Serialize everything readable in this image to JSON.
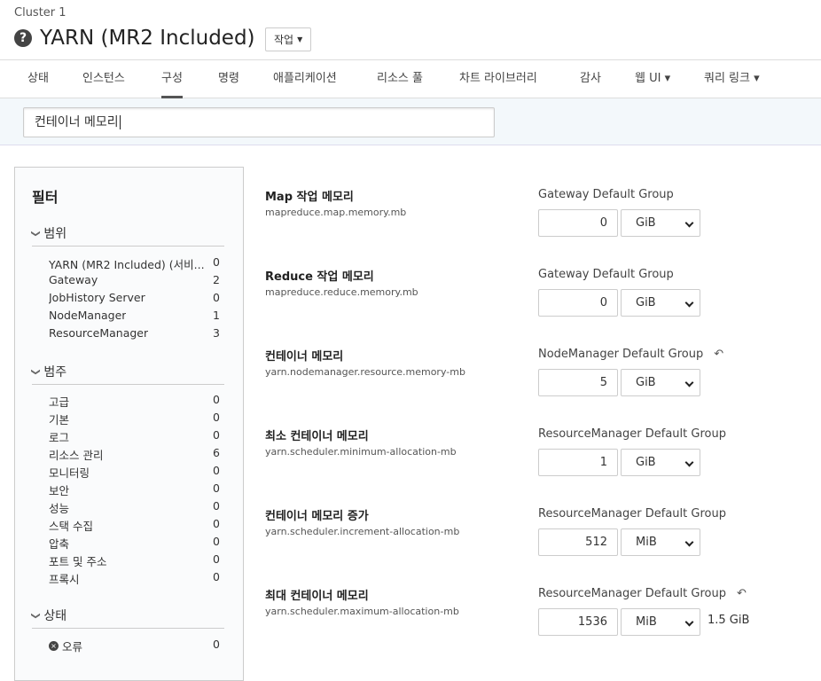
{
  "header": {
    "cluster": "Cluster 1",
    "title": "YARN (MR2 Included)",
    "action": "작업"
  },
  "tabs": [
    "상태",
    "인스턴스",
    "구성",
    "명령",
    "애플리케이션",
    "리소스 풀",
    "차트 라이브러리",
    "감사",
    "웹 UI",
    "쿼리 링크"
  ],
  "search": {
    "value": "컨테이너 메모리"
  },
  "filter": {
    "title": "필터",
    "scope": {
      "label": "범위",
      "items": [
        [
          "YARN (MR2 Included) (서비...",
          "0"
        ],
        [
          "Gateway",
          "2"
        ],
        [
          "JobHistory Server",
          "0"
        ],
        [
          "NodeManager",
          "1"
        ],
        [
          "ResourceManager",
          "3"
        ]
      ]
    },
    "category": {
      "label": "범주",
      "items": [
        [
          "고급",
          "0"
        ],
        [
          "기본",
          "0"
        ],
        [
          "로그",
          "0"
        ],
        [
          "리소스 관리",
          "6"
        ],
        [
          "모니터링",
          "0"
        ],
        [
          "보안",
          "0"
        ],
        [
          "성능",
          "0"
        ],
        [
          "스택 수집",
          "0"
        ],
        [
          "압축",
          "0"
        ],
        [
          "포트 및 주소",
          "0"
        ],
        [
          "프록시",
          "0"
        ]
      ]
    },
    "status": {
      "label": "상태",
      "items": [
        [
          "오류",
          "0"
        ]
      ]
    }
  },
  "params": [
    {
      "name": "Map 작업 메모리",
      "key": "mapreduce.map.memory.mb",
      "group": "Gateway Default Group",
      "value": "0",
      "unit": "GiB"
    },
    {
      "name": "Reduce 작업 메모리",
      "key": "mapreduce.reduce.memory.mb",
      "group": "Gateway Default Group",
      "value": "0",
      "unit": "GiB"
    },
    {
      "name": "컨테이너 메모리",
      "key": "yarn.nodemanager.resource.memory-mb",
      "group": "NodeManager Default Group",
      "value": "5",
      "unit": "GiB",
      "undo": true
    },
    {
      "name": "최소 컨테이너 메모리",
      "key": "yarn.scheduler.minimum-allocation-mb",
      "group": "ResourceManager Default Group",
      "value": "1",
      "unit": "GiB"
    },
    {
      "name": "컨테이너 메모리 증가",
      "key": "yarn.scheduler.increment-allocation-mb",
      "group": "ResourceManager Default Group",
      "value": "512",
      "unit": "MiB"
    },
    {
      "name": "최대 컨테이너 메모리",
      "key": "yarn.scheduler.maximum-allocation-mb",
      "group": "ResourceManager Default Group",
      "value": "1536",
      "unit": "MiB",
      "undo": true,
      "extra": "1.5 GiB"
    }
  ]
}
